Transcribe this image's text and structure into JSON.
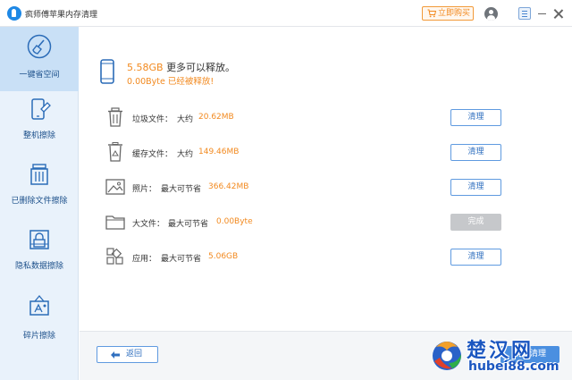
{
  "titlebar": {
    "app_title": "疯师傅苹果内存清理",
    "buy_label": "立即购买"
  },
  "sidebar": {
    "items": [
      {
        "label": "一键省空间",
        "icon": "broom-icon",
        "active": true
      },
      {
        "label": "整机擦除",
        "icon": "phone-eraser-icon",
        "active": false
      },
      {
        "label": "已删除文件擦除",
        "icon": "trash-file-icon",
        "active": false
      },
      {
        "label": "隐私数据擦除",
        "icon": "privacy-lock-icon",
        "active": false
      },
      {
        "label": "碎片擦除",
        "icon": "fragment-icon",
        "active": false
      }
    ]
  },
  "summary": {
    "total": "5.58GB",
    "total_suffix": "更多可以释放。",
    "freed": "0.00Byte",
    "freed_suffix": "已经被释放!"
  },
  "rows": [
    {
      "name": "垃圾文件：",
      "prefix": "大约",
      "size": "20.62MB",
      "button": "清理",
      "done": false,
      "icon": "trash-can-icon"
    },
    {
      "name": "缓存文件：",
      "prefix": "大约",
      "size": "149.46MB",
      "button": "清理",
      "done": false,
      "icon": "recycle-bin-icon"
    },
    {
      "name": "照片：",
      "prefix": "最大可节省",
      "size": "366.42MB",
      "button": "清理",
      "done": false,
      "icon": "photo-icon"
    },
    {
      "name": "大文件：",
      "prefix": "最大可节省",
      "size": "0.00Byte",
      "button": "完成",
      "done": true,
      "icon": "folder-icon"
    },
    {
      "name": "应用：",
      "prefix": "最大可节省",
      "size": "5.06GB",
      "button": "清理",
      "done": false,
      "icon": "apps-grid-icon"
    }
  ],
  "footer": {
    "back_label": "返回",
    "clean_label": "一键清理"
  },
  "watermark": {
    "text": "楚汉网",
    "url": "hubei88.com"
  },
  "colors": {
    "accent": "#f28a20",
    "primary": "#2f6fbf",
    "sidebar_bg": "#e9f2fb",
    "sidebar_active": "#c9e0f6"
  }
}
